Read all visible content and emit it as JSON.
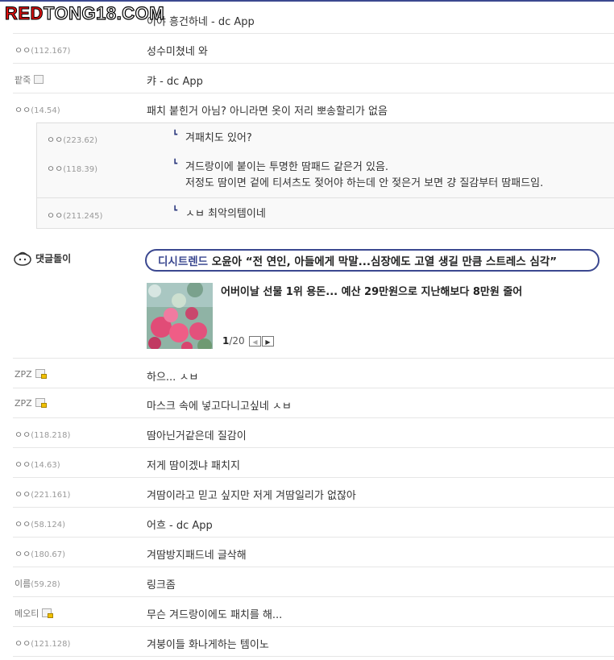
{
  "watermark": {
    "part1": "RED",
    "part2": "TONG18.COM"
  },
  "comments_top": [
    {
      "nick": "",
      "ip": "",
      "memo": "이야 흥건하네 - dc App"
    },
    {
      "nick": "ㅇㅇ",
      "ip": "(112.167)",
      "memo": "성수미쳤네 와"
    },
    {
      "nick": "팥죽",
      "ip": "",
      "icon": "fixed-nick-icon",
      "memo": "캬 - dc App"
    },
    {
      "nick": "ㅇㅇ",
      "ip": "(14.54)",
      "memo": "패치 붙힌거 아님? 아니라면 옷이 저리 뽀송할리가 없음"
    }
  ],
  "replies": [
    {
      "nick": "ㅇㅇ",
      "ip": "(223.62)",
      "memo": "겨패치도 있어?"
    },
    {
      "nick": "ㅇㅇ",
      "ip": "(118.39)",
      "memo": "겨드랑이에 붙이는 투명한 땀패드 같은거 있음.",
      "memo2": "저정도 땀이면 겉에 티셔츠도 젖어야 하는데 안 젖은거 보면 걍 질감부터 땀패드임."
    },
    {
      "nick": "ㅇㅇ",
      "ip": "(211.245)",
      "memo": "ㅅㅂ 최악의템이네"
    }
  ],
  "ad": {
    "label": "댓글돌이",
    "trend_keyword": "디시트렌드",
    "trend_text": " 오윤아 “전 연인, 아들에게 막말...심장에도 고열 생길 만큼 스트레스 심각”",
    "news_title": "어버이날 선물 1위 용돈... 예산 29만원으로 지난해보다 8만원 줄어",
    "page_current": "1",
    "page_total": "/20",
    "prev_icon": "chevron-left-icon",
    "next_icon": "chevron-right-icon"
  },
  "comments_bottom": [
    {
      "nick": "ZPZ",
      "ip": "",
      "icon": "gallog-icon",
      "memo": "하으... ㅅㅂ"
    },
    {
      "nick": "ZPZ",
      "ip": "",
      "icon": "gallog-icon",
      "memo": "마스크 속에 넣고다니고싶네 ㅅㅂ"
    },
    {
      "nick": "ㅇㅇ",
      "ip": "(118.218)",
      "memo": "땀아닌거같은데 질감이"
    },
    {
      "nick": "ㅇㅇ",
      "ip": "(14.63)",
      "memo": "저게 땀이겠냐 패치지"
    },
    {
      "nick": "ㅇㅇ",
      "ip": "(221.161)",
      "memo": "겨땀이라고 믿고 싶지만 저게 겨땀일리가 없잖아"
    },
    {
      "nick": "ㅇㅇ",
      "ip": "(58.124)",
      "memo": "어흐 - dc App"
    },
    {
      "nick": "ㅇㅇ",
      "ip": "(180.67)",
      "memo": "겨땀방지패드네 글삭해"
    },
    {
      "nick": "이름",
      "ip": "(59.28)",
      "memo": "링크좀"
    },
    {
      "nick": "메오티",
      "ip": "",
      "icon": "gallog-icon",
      "memo": "무슨 겨드랑이에도 패치를 해..."
    },
    {
      "nick": "ㅇㅇ",
      "ip": "(121.128)",
      "memo": "겨붕이들 화나게하는 템이노"
    }
  ],
  "colors": {
    "accent": "#3b4890",
    "watermark_red": "#e01010"
  }
}
